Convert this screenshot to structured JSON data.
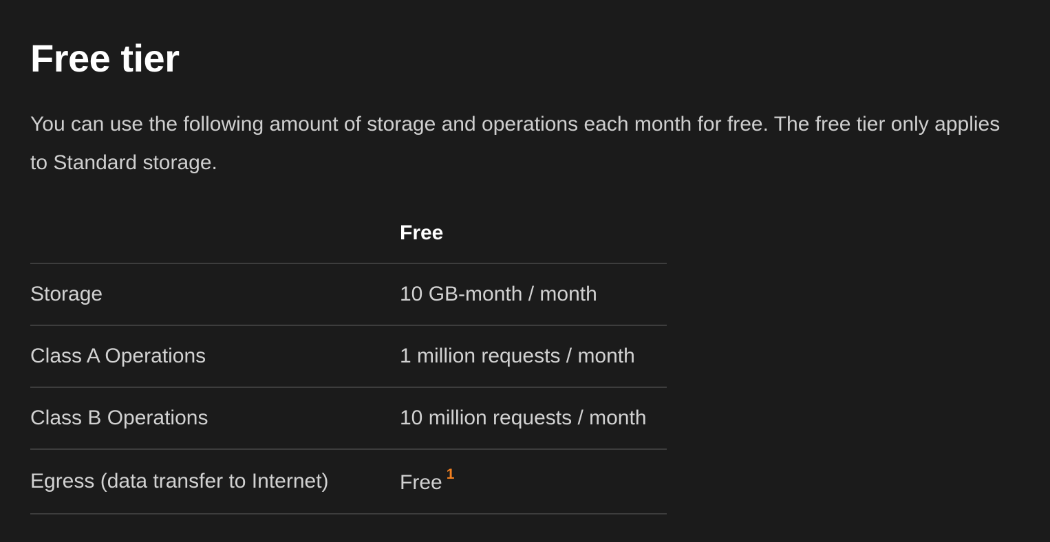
{
  "section": {
    "title": "Free tier",
    "intro": "You can use the following amount of storage and operations each month for free. The free tier only applies to Standard storage."
  },
  "table": {
    "headers": [
      "",
      "Free"
    ],
    "rows": [
      {
        "label": "Storage",
        "value": "10 GB-month / month"
      },
      {
        "label": "Class A Operations",
        "value": "1 million requests / month"
      },
      {
        "label": "Class B Operations",
        "value": "10 million requests / month"
      },
      {
        "label": "Egress (data transfer to Internet)",
        "value": "Free",
        "footnote": "1"
      }
    ]
  },
  "colors": {
    "background": "#1b1b1b",
    "footnote_accent": "#f38020"
  }
}
